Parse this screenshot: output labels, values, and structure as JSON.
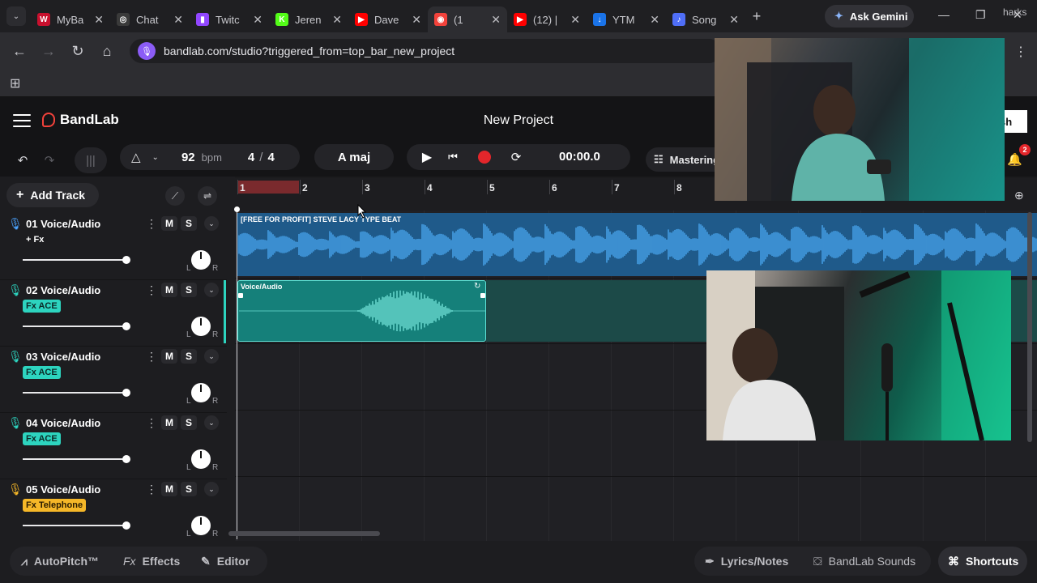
{
  "browser": {
    "tabs": [
      {
        "label": "MyBa",
        "color": "#c8102e",
        "glyph": "W",
        "active": false
      },
      {
        "label": "Chat",
        "color": "#3a3a3a",
        "glyph": "◎",
        "active": false
      },
      {
        "label": "Twitc",
        "color": "#9146ff",
        "glyph": "▮",
        "active": false
      },
      {
        "label": "Jeren",
        "color": "#53fc18",
        "glyph": "K",
        "active": false
      },
      {
        "label": "Dave",
        "color": "#ff0000",
        "glyph": "▶",
        "active": false
      },
      {
        "label": "(1",
        "color": "#f2423b",
        "glyph": "◉",
        "active": true
      },
      {
        "label": "(12) |",
        "color": "#ff0000",
        "glyph": "▶",
        "active": false
      },
      {
        "label": "YTM",
        "color": "#1a73e8",
        "glyph": "↓",
        "active": false
      },
      {
        "label": "Song",
        "color": "#4f6ef7",
        "glyph": "♪",
        "active": false
      }
    ],
    "gemini_label": "Ask Gemini",
    "url": "bandlab.com/studio?triggered_from=top_bar_new_project",
    "bookmarks_trunc": "harks"
  },
  "app": {
    "brand": "BandLab",
    "project_title": "New Project",
    "publish_label": "sh"
  },
  "transport": {
    "bpm": "92",
    "bpm_unit": "bpm",
    "time_sig_num": "4",
    "time_sig_sep": "/",
    "time_sig_den": "4",
    "key": "A maj",
    "time": "00:00.0",
    "mastering_label": "Mastering",
    "notifications": "2"
  },
  "left_panel": {
    "add_track_label": "Add Track"
  },
  "tracks": [
    {
      "number": "01",
      "name": "Voice/Audio",
      "fx": "+ Fx",
      "fx_style": "plain",
      "mic_color": "#4aa3ff",
      "mute": "M",
      "solo": "S",
      "pan_l": "L",
      "pan_r": "R"
    },
    {
      "number": "02",
      "name": "Voice/Audio",
      "fx": "Fx ACE",
      "fx_style": "ace",
      "mic_color": "#2dd4bf",
      "mute": "M",
      "solo": "S",
      "pan_l": "L",
      "pan_r": "R"
    },
    {
      "number": "03",
      "name": "Voice/Audio",
      "fx": "Fx ACE",
      "fx_style": "ace",
      "mic_color": "#2dd4bf",
      "mute": "M",
      "solo": "S",
      "pan_l": "L",
      "pan_r": "R"
    },
    {
      "number": "04",
      "name": "Voice/Audio",
      "fx": "Fx ACE",
      "fx_style": "ace",
      "mic_color": "#2dd4bf",
      "mute": "M",
      "solo": "S",
      "pan_l": "L",
      "pan_r": "R"
    },
    {
      "number": "05",
      "name": "Voice/Audio",
      "fx": "Fx Telephone",
      "fx_style": "tel",
      "mic_color": "#f5b728",
      "mute": "M",
      "solo": "S",
      "pan_l": "L",
      "pan_r": "R"
    }
  ],
  "ruler": {
    "bars": [
      "1",
      "2",
      "3",
      "4",
      "5",
      "6",
      "7",
      "8"
    ]
  },
  "clips": {
    "clip1_label": "[FREE FOR PROFIT] STEVE LACY TYPE BEAT",
    "clip2_label": "Voice/Audio"
  },
  "bottom": {
    "autopitch": "AutoPitch™",
    "effects": "Effects",
    "editor": "Editor",
    "lyrics": "Lyrics/Notes",
    "sounds": "BandLab Sounds",
    "shortcuts": "Shortcuts"
  }
}
